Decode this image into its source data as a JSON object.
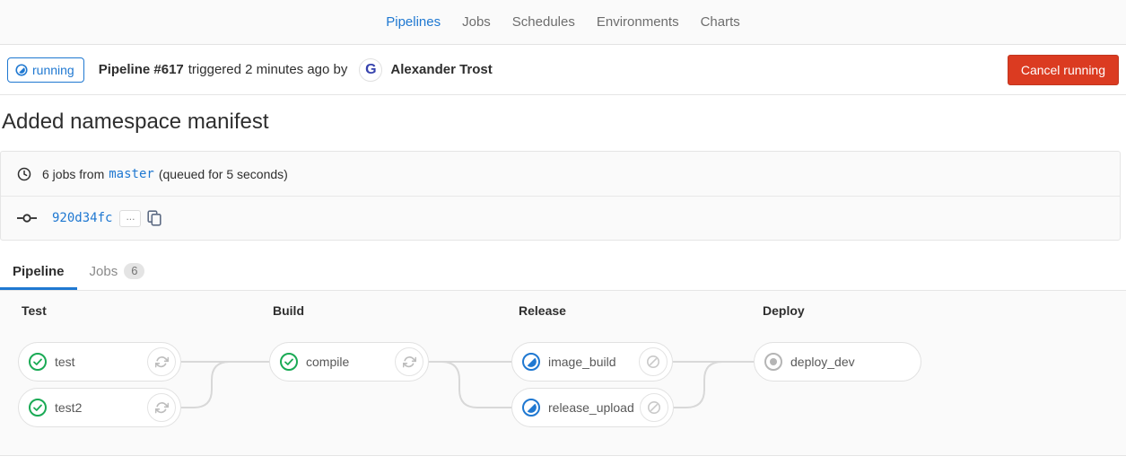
{
  "nav": {
    "items": [
      {
        "label": "Pipelines",
        "active": true
      },
      {
        "label": "Jobs",
        "active": false
      },
      {
        "label": "Schedules",
        "active": false
      },
      {
        "label": "Environments",
        "active": false
      },
      {
        "label": "Charts",
        "active": false
      }
    ]
  },
  "header": {
    "status_badge_label": "running",
    "pipeline_id_label": "Pipeline #617",
    "triggered_text": "triggered 2 minutes ago by",
    "avatar_letter": "G",
    "user_name": "Alexander Trost",
    "cancel_button_label": "Cancel running"
  },
  "page_title": "Added namespace manifest",
  "summary": {
    "jobs_text": "6 jobs from",
    "branch_name": "master",
    "queued_text": "(queued for 5 seconds)"
  },
  "commit": {
    "short_sha": "920d34fc",
    "ellipsis_label": "..."
  },
  "tabs": {
    "pipeline_label": "Pipeline",
    "jobs_label": "Jobs",
    "jobs_count": "6"
  },
  "graph": {
    "stages": [
      {
        "name": "Test",
        "jobs": [
          {
            "name": "test",
            "status": "success",
            "action": "retry"
          },
          {
            "name": "test2",
            "status": "success",
            "action": "retry"
          }
        ]
      },
      {
        "name": "Build",
        "jobs": [
          {
            "name": "compile",
            "status": "success",
            "action": "retry"
          }
        ]
      },
      {
        "name": "Release",
        "jobs": [
          {
            "name": "image_build",
            "status": "running",
            "action": "cancel"
          },
          {
            "name": "release_upload",
            "status": "running",
            "action": "cancel"
          }
        ]
      },
      {
        "name": "Deploy",
        "jobs": [
          {
            "name": "deploy_dev",
            "status": "created",
            "action": "none"
          }
        ]
      }
    ]
  },
  "icons": {
    "status_success": "check-circle-icon",
    "status_running": "running-spinner-icon",
    "status_created": "dot-circle-icon",
    "retry": "retry-icon",
    "cancel": "cancel-icon",
    "clock": "clock-icon",
    "commit": "commit-icon",
    "copy": "copy-to-clipboard-icon"
  },
  "colors": {
    "accent_blue": "#1f78d1",
    "success_green": "#1aaa55",
    "danger_red": "#db3b21",
    "created_gray": "#b5b5b5",
    "graph_bg": "#fafafa"
  }
}
